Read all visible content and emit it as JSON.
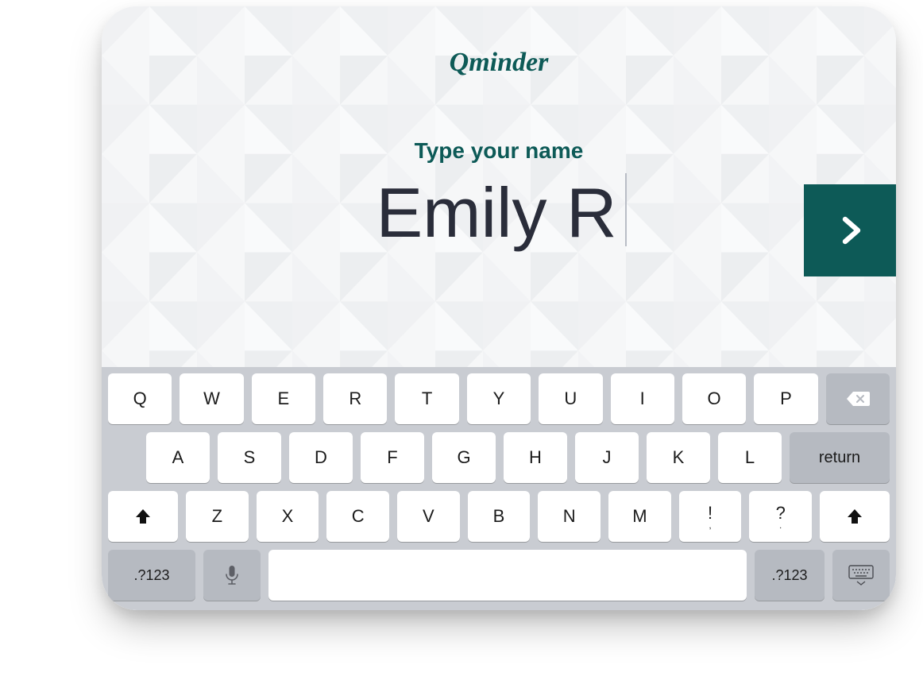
{
  "brand": {
    "name": "Qminder",
    "color": "#0d5a57"
  },
  "prompt": "Type your name",
  "input_value": "Emily R",
  "next_button": {
    "icon": "chevron-right",
    "bg": "#0d5a57"
  },
  "keyboard": {
    "row1": [
      "Q",
      "W",
      "E",
      "R",
      "T",
      "Y",
      "U",
      "I",
      "O",
      "P"
    ],
    "backspace_icon": "backspace",
    "row2": [
      "A",
      "S",
      "D",
      "F",
      "G",
      "H",
      "J",
      "K",
      "L"
    ],
    "return_label": "return",
    "row3": [
      "Z",
      "X",
      "C",
      "V",
      "B",
      "N",
      "M"
    ],
    "punct1_top": "!",
    "punct1_bottom": ",",
    "punct2_top": "?",
    "punct2_bottom": ".",
    "shift_icon": "shift",
    "mode_label": ".?123",
    "mic_icon": "microphone",
    "hide_icon": "hide-keyboard"
  }
}
